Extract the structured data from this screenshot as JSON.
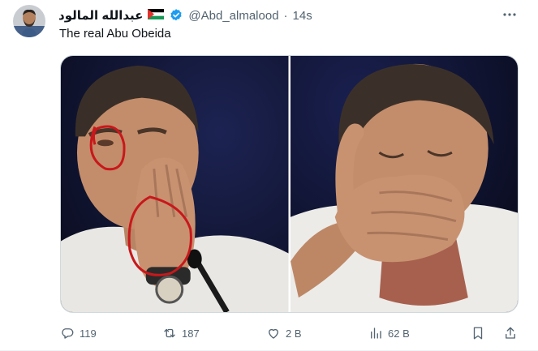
{
  "post": {
    "author_name": "عبدالله المالود",
    "flag": "palestine-flag",
    "handle": "@Abd_almalood",
    "separator": "·",
    "time": "14s",
    "text": "The real Abu Obeida"
  },
  "media": {
    "left_photo": "man-pointing-cheek-with-red-circles",
    "right_photo": "man-covering-face-crying"
  },
  "actions": {
    "replies": "119",
    "reposts": "187",
    "likes": "2 B",
    "views": "62 B"
  },
  "colors": {
    "text": "#0f1419",
    "secondary": "#536471",
    "verified": "#1d9bf0",
    "border": "#cfd9de"
  }
}
